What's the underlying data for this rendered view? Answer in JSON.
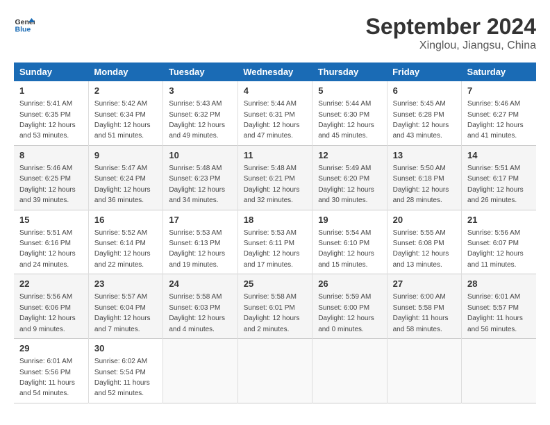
{
  "header": {
    "logo_line1": "General",
    "logo_line2": "Blue",
    "title": "September 2024",
    "subtitle": "Xinglou, Jiangsu, China"
  },
  "weekdays": [
    "Sunday",
    "Monday",
    "Tuesday",
    "Wednesday",
    "Thursday",
    "Friday",
    "Saturday"
  ],
  "weeks": [
    [
      {
        "day": "1",
        "sunrise": "Sunrise: 5:41 AM",
        "sunset": "Sunset: 6:35 PM",
        "daylight": "Daylight: 12 hours and 53 minutes."
      },
      {
        "day": "2",
        "sunrise": "Sunrise: 5:42 AM",
        "sunset": "Sunset: 6:34 PM",
        "daylight": "Daylight: 12 hours and 51 minutes."
      },
      {
        "day": "3",
        "sunrise": "Sunrise: 5:43 AM",
        "sunset": "Sunset: 6:32 PM",
        "daylight": "Daylight: 12 hours and 49 minutes."
      },
      {
        "day": "4",
        "sunrise": "Sunrise: 5:44 AM",
        "sunset": "Sunset: 6:31 PM",
        "daylight": "Daylight: 12 hours and 47 minutes."
      },
      {
        "day": "5",
        "sunrise": "Sunrise: 5:44 AM",
        "sunset": "Sunset: 6:30 PM",
        "daylight": "Daylight: 12 hours and 45 minutes."
      },
      {
        "day": "6",
        "sunrise": "Sunrise: 5:45 AM",
        "sunset": "Sunset: 6:28 PM",
        "daylight": "Daylight: 12 hours and 43 minutes."
      },
      {
        "day": "7",
        "sunrise": "Sunrise: 5:46 AM",
        "sunset": "Sunset: 6:27 PM",
        "daylight": "Daylight: 12 hours and 41 minutes."
      }
    ],
    [
      {
        "day": "8",
        "sunrise": "Sunrise: 5:46 AM",
        "sunset": "Sunset: 6:25 PM",
        "daylight": "Daylight: 12 hours and 39 minutes."
      },
      {
        "day": "9",
        "sunrise": "Sunrise: 5:47 AM",
        "sunset": "Sunset: 6:24 PM",
        "daylight": "Daylight: 12 hours and 36 minutes."
      },
      {
        "day": "10",
        "sunrise": "Sunrise: 5:48 AM",
        "sunset": "Sunset: 6:23 PM",
        "daylight": "Daylight: 12 hours and 34 minutes."
      },
      {
        "day": "11",
        "sunrise": "Sunrise: 5:48 AM",
        "sunset": "Sunset: 6:21 PM",
        "daylight": "Daylight: 12 hours and 32 minutes."
      },
      {
        "day": "12",
        "sunrise": "Sunrise: 5:49 AM",
        "sunset": "Sunset: 6:20 PM",
        "daylight": "Daylight: 12 hours and 30 minutes."
      },
      {
        "day": "13",
        "sunrise": "Sunrise: 5:50 AM",
        "sunset": "Sunset: 6:18 PM",
        "daylight": "Daylight: 12 hours and 28 minutes."
      },
      {
        "day": "14",
        "sunrise": "Sunrise: 5:51 AM",
        "sunset": "Sunset: 6:17 PM",
        "daylight": "Daylight: 12 hours and 26 minutes."
      }
    ],
    [
      {
        "day": "15",
        "sunrise": "Sunrise: 5:51 AM",
        "sunset": "Sunset: 6:16 PM",
        "daylight": "Daylight: 12 hours and 24 minutes."
      },
      {
        "day": "16",
        "sunrise": "Sunrise: 5:52 AM",
        "sunset": "Sunset: 6:14 PM",
        "daylight": "Daylight: 12 hours and 22 minutes."
      },
      {
        "day": "17",
        "sunrise": "Sunrise: 5:53 AM",
        "sunset": "Sunset: 6:13 PM",
        "daylight": "Daylight: 12 hours and 19 minutes."
      },
      {
        "day": "18",
        "sunrise": "Sunrise: 5:53 AM",
        "sunset": "Sunset: 6:11 PM",
        "daylight": "Daylight: 12 hours and 17 minutes."
      },
      {
        "day": "19",
        "sunrise": "Sunrise: 5:54 AM",
        "sunset": "Sunset: 6:10 PM",
        "daylight": "Daylight: 12 hours and 15 minutes."
      },
      {
        "day": "20",
        "sunrise": "Sunrise: 5:55 AM",
        "sunset": "Sunset: 6:08 PM",
        "daylight": "Daylight: 12 hours and 13 minutes."
      },
      {
        "day": "21",
        "sunrise": "Sunrise: 5:56 AM",
        "sunset": "Sunset: 6:07 PM",
        "daylight": "Daylight: 12 hours and 11 minutes."
      }
    ],
    [
      {
        "day": "22",
        "sunrise": "Sunrise: 5:56 AM",
        "sunset": "Sunset: 6:06 PM",
        "daylight": "Daylight: 12 hours and 9 minutes."
      },
      {
        "day": "23",
        "sunrise": "Sunrise: 5:57 AM",
        "sunset": "Sunset: 6:04 PM",
        "daylight": "Daylight: 12 hours and 7 minutes."
      },
      {
        "day": "24",
        "sunrise": "Sunrise: 5:58 AM",
        "sunset": "Sunset: 6:03 PM",
        "daylight": "Daylight: 12 hours and 4 minutes."
      },
      {
        "day": "25",
        "sunrise": "Sunrise: 5:58 AM",
        "sunset": "Sunset: 6:01 PM",
        "daylight": "Daylight: 12 hours and 2 minutes."
      },
      {
        "day": "26",
        "sunrise": "Sunrise: 5:59 AM",
        "sunset": "Sunset: 6:00 PM",
        "daylight": "Daylight: 12 hours and 0 minutes."
      },
      {
        "day": "27",
        "sunrise": "Sunrise: 6:00 AM",
        "sunset": "Sunset: 5:58 PM",
        "daylight": "Daylight: 11 hours and 58 minutes."
      },
      {
        "day": "28",
        "sunrise": "Sunrise: 6:01 AM",
        "sunset": "Sunset: 5:57 PM",
        "daylight": "Daylight: 11 hours and 56 minutes."
      }
    ],
    [
      {
        "day": "29",
        "sunrise": "Sunrise: 6:01 AM",
        "sunset": "Sunset: 5:56 PM",
        "daylight": "Daylight: 11 hours and 54 minutes."
      },
      {
        "day": "30",
        "sunrise": "Sunrise: 6:02 AM",
        "sunset": "Sunset: 5:54 PM",
        "daylight": "Daylight: 11 hours and 52 minutes."
      },
      null,
      null,
      null,
      null,
      null
    ]
  ]
}
